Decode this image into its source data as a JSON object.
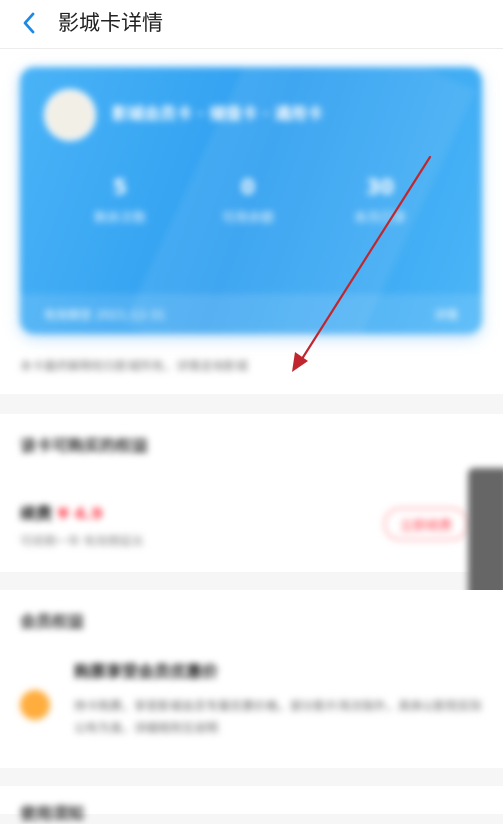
{
  "header": {
    "title": "影城卡详情"
  },
  "card": {
    "name": "影城会员卡 · 储值卡 · 通用卡",
    "stats": [
      {
        "value": "5",
        "label": "剩余次数"
      },
      {
        "value": "0",
        "label": "可用余额"
      },
      {
        "value": "30",
        "label": "本月已享"
      }
    ],
    "footer_left": "有效期至 2021-12-31",
    "footer_right": "详情"
  },
  "notice": "本卡最终解释权归影城所有，详情咨询影城",
  "purchase": {
    "section_title": "该卡可购买的权益",
    "item_title": "续费",
    "item_price": "¥ 4.9",
    "item_sub": "可续期一年·有效期延长",
    "button_label": "立即续费"
  },
  "benefits": {
    "section_title": "会员权益",
    "item_title": "购票享受会员优惠价",
    "item_desc": "持卡购票，享受影城会员专属优惠价格，部分影片场次除外，具体以影院实际公布为准，详细规则见说明"
  },
  "bottom": {
    "section_title": "使用须知"
  },
  "colors": {
    "accent": "#2f9ff0",
    "price": "#ff3b4a",
    "arrow": "#c0262d"
  }
}
